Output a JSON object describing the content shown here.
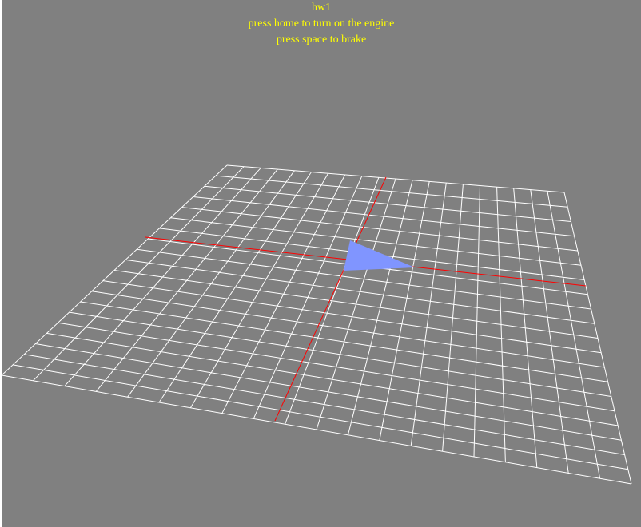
{
  "hud": {
    "title": "hw1",
    "line1": "press home to turn on the engine",
    "line2": "press space to brake",
    "text_color": "#ffff00"
  },
  "scene": {
    "background_color": "#808080",
    "grid_color": "#ffffff",
    "axis_color": "#ff0000",
    "vehicle_color": "#8095ff",
    "vehicle_shape": "triangle"
  }
}
